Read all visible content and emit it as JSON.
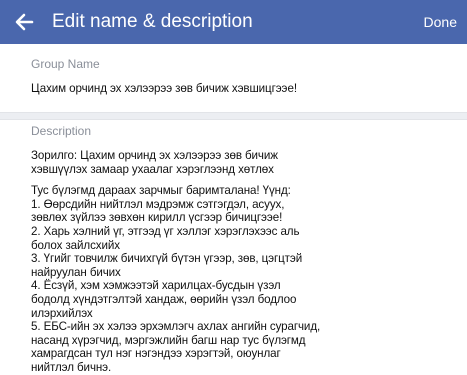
{
  "header": {
    "title": "Edit name & description",
    "done_label": "Done",
    "back_icon": "arrow-left-icon"
  },
  "colors": {
    "accent": "#4a67ad"
  },
  "group_name": {
    "label": "Group Name",
    "value": "Цахим орчинд эх хэлээрээ зөв бичиж хэвшицгээе!"
  },
  "description": {
    "label": "Description",
    "lines": [
      "Зорилго: Цахим орчинд эх хэлээрээ зөв бичиж",
      "хэвшүүлэх замаар ухаалаг хэрэглээнд хөтлөх",
      "Тус бүлэгмд дараах зарчмыг баримталана! Үүнд:",
      "1. Өөрсдийн нийтлэл мэдрэмж сэтгэгдэл, асуух,",
      "зөвлөх зүйлээ зөвхөн кирилл үсгээр бичицгээе!",
      "2. Харь хэлний үг, этгээд үг хэллэг хэрэглэхээс аль",
      "болох зайлсхийх",
      "3. Үгийг товчилж бичихгүй бүтэн үгээр, зөв, цэгцтэй",
      "найруулан бичих",
      "4. Ёсзүй, хэм хэмжээтэй харилцах-бусдын үзэл",
      "бодолд хүндэтгэлтэй хандаж, өөрийн үзэл бодлоо",
      "илэрхийлэх",
      "5. ЕБС-ийн эх хэлээ эрхэмлэгч ахлах ангийн сурагчид,",
      "насанд хүрэгчид, мэргэжлийн багш нар тус бүлэгмд",
      "хамрагдсан тул нэг нэгэндээ хэрэгтэй, оюунлаг",
      "нийтлэл бичнэ."
    ]
  }
}
